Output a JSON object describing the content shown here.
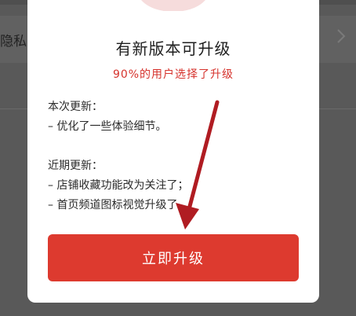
{
  "background": {
    "row_label": "隐私"
  },
  "dialog": {
    "title": "有新版本可升级",
    "subtitle": "90%的用户选择了升级",
    "notes": [
      {
        "heading": "本次更新：",
        "items": [
          "– 优化了一些体验细节。"
        ]
      },
      {
        "heading": "近期更新：",
        "items": [
          "– 店铺收藏功能改为关注了；",
          "– 首页频道图标视觉升级了。"
        ]
      }
    ],
    "upgrade_button": "立即升级"
  },
  "colors": {
    "accent": "#dd3a2f",
    "subtitle": "#d6332d",
    "annotation_arrow": "#b01c22"
  },
  "icons": {
    "header": "red-graphic-icon",
    "row_chevron": "chevron-right-icon",
    "annotation": "arrow-pointer-icon"
  }
}
